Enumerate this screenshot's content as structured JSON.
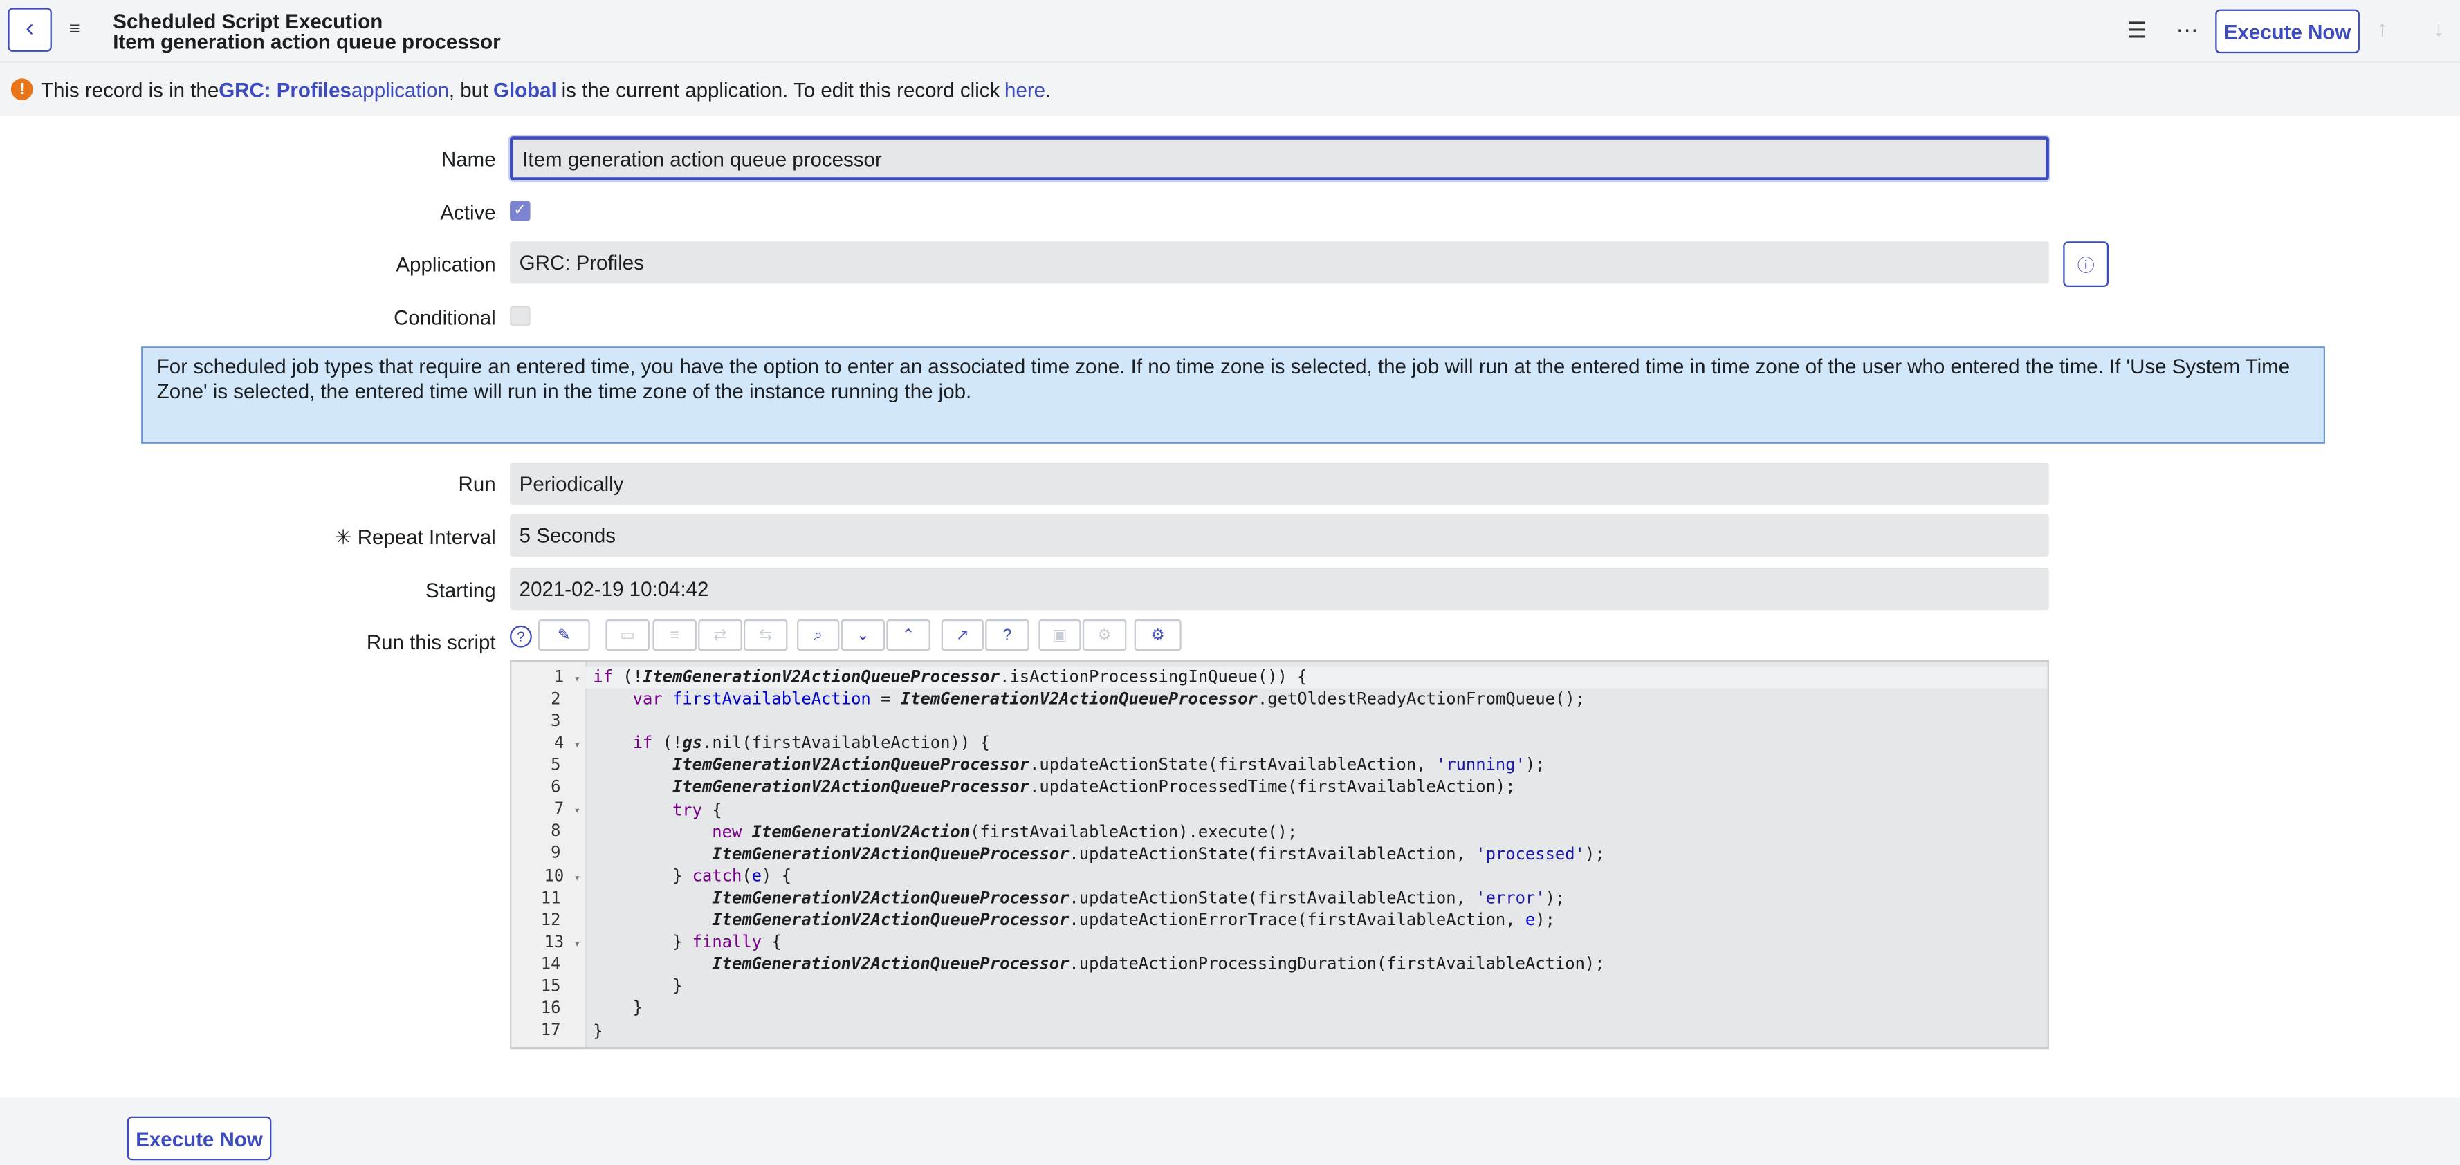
{
  "header": {
    "title": "Scheduled Script Execution",
    "subtitle": "Item generation action queue processor",
    "execute_now": "Execute Now"
  },
  "notice": {
    "pre": "This record is in the ",
    "app_bold": "GRC: Profiles",
    "app_word": " application",
    "mid": ", but ",
    "global": "Global",
    "post": " is the current application. To edit this record click ",
    "here": "here",
    "end": "."
  },
  "form": {
    "name_label": "Name",
    "name_value": "Item generation action queue processor",
    "active_label": "Active",
    "application_label": "Application",
    "application_value": "GRC: Profiles",
    "conditional_label": "Conditional",
    "info_text": "For scheduled job types that require an entered time, you have the option to enter an associated time zone. If no time zone is selected, the job will run at the entered time in time zone of the user who entered the time. If 'Use System Time Zone' is selected, the entered time will run in the time zone of the instance running the job.",
    "run_label": "Run",
    "run_value": "Periodically",
    "repeat_label": "Repeat Interval",
    "repeat_value": "5 Seconds",
    "starting_label": "Starting",
    "starting_value": "2021-02-19 10:04:42",
    "script_label": "Run this script"
  },
  "footer": {
    "execute_now": "Execute Now"
  }
}
